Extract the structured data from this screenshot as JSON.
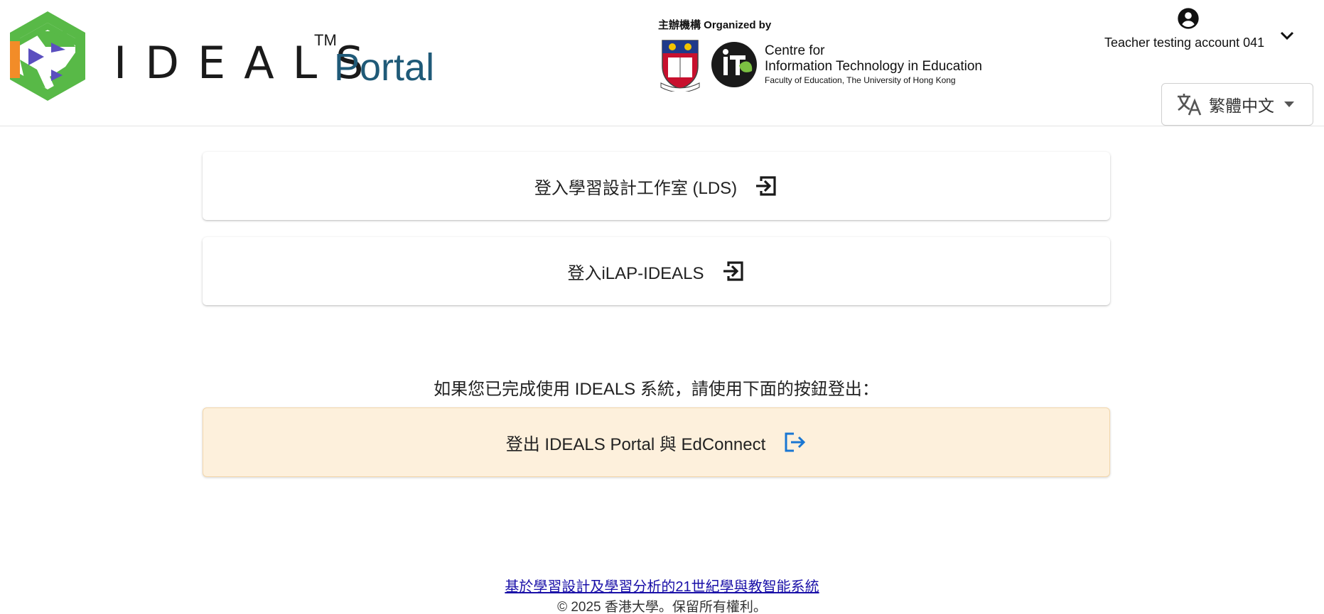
{
  "header": {
    "logo": {
      "wordmark": "IDEALS",
      "trademark": "TM",
      "portal": "Portal",
      "icon": "ideals-logo-icon"
    },
    "organizer": {
      "caption": "主辦機構 Organized by",
      "line1": "Centre for",
      "line2": "Information Technology in Education",
      "line3": "Faculty of Education, The University of Hong Kong",
      "crest_icon": "hku-crest-icon",
      "cite_icon": "cite-logo-icon"
    },
    "account": {
      "name": "Teacher testing account 041",
      "avatar_icon": "account-circle-icon",
      "chevron_icon": "chevron-down-icon"
    },
    "language": {
      "label": "繁體中文",
      "icon": "translate-icon",
      "caret_icon": "caret-down-icon"
    }
  },
  "main": {
    "lds_button": "登入學習設計工作室 (LDS)",
    "ilap_button": "登入iLAP-IDEALS",
    "logout_notice": "如果您已完成使用 IDEALS 系統，請使用下面的按鈕登出：",
    "logout_button": "登出 IDEALS Portal 與 EdConnect",
    "login_icon": "login-icon",
    "logout_icon": "logout-icon"
  },
  "footer": {
    "link": "基於學習設計及學習分析的21世紀學與教智能系統",
    "copyright": "© 2025 香港大學。保留所有權利。"
  },
  "colors": {
    "brand_blue": "#1f5a78",
    "logo_green": "#58b947",
    "logo_orange": "#f28c28",
    "logo_purple": "#5b4fbf",
    "logout_bg": "#fdf0dc",
    "logout_icon": "#1976d2",
    "link": "#1a10a8"
  }
}
